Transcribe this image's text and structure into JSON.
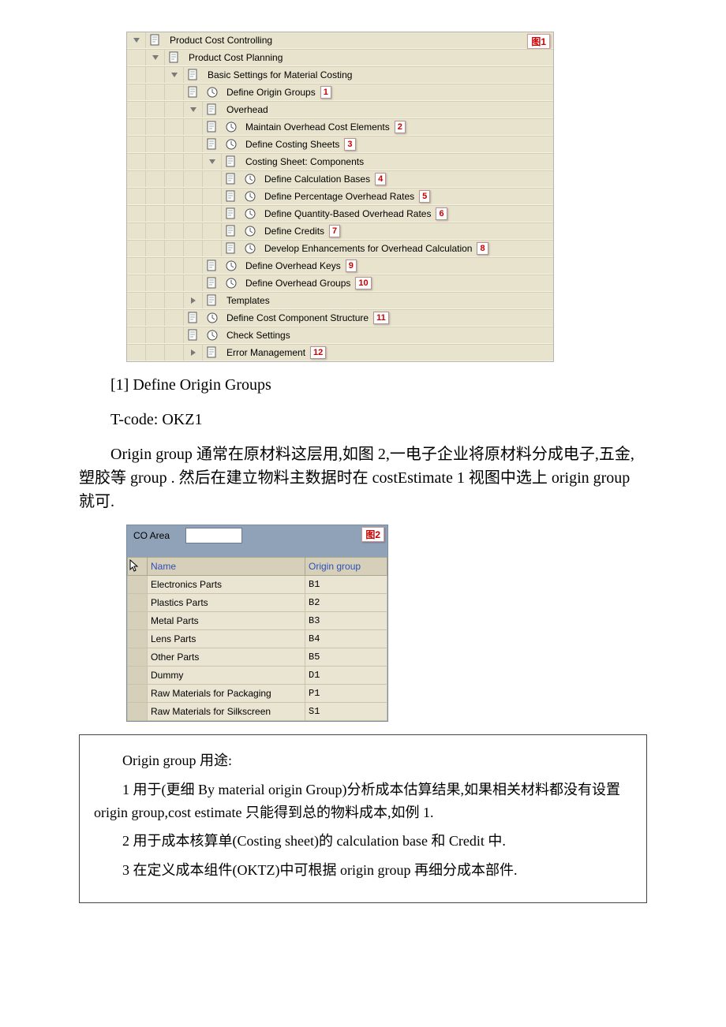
{
  "figure1_label": "图1",
  "figure2_label": "图2",
  "tree": {
    "node_pcc": "Product Cost Controlling",
    "node_pcp": "Product Cost Planning",
    "node_bsmc": "Basic Settings for Material Costing",
    "node_dog": "Define Origin Groups",
    "node_oh": "Overhead",
    "node_moce": "Maintain Overhead Cost Elements",
    "node_dcs": "Define Costing Sheets",
    "node_csc": "Costing Sheet: Components",
    "node_dcb": "Define Calculation Bases",
    "node_dpor": "Define Percentage Overhead Rates",
    "node_dqbor": "Define Quantity-Based Overhead Rates",
    "node_dc": "Define Credits",
    "node_deoc": "Develop Enhancements for Overhead Calculation",
    "node_dok": "Define Overhead Keys",
    "node_dogr": "Define Overhead Groups",
    "node_tpl": "Templates",
    "node_dccs": "Define Cost Component Structure",
    "node_cs": "Check Settings",
    "node_em": "Error Management",
    "nums": {
      "n1": "1",
      "n2": "2",
      "n3": "3",
      "n4": "4",
      "n5": "5",
      "n6": "6",
      "n7": "7",
      "n8": "8",
      "n9": "9",
      "n10": "10",
      "n11": "11",
      "n12": "12"
    }
  },
  "text": {
    "p1": "[1] Define Origin Groups",
    "p2": "T-code: OKZ1",
    "p3": "Origin group 通常在原材料这层用,如图 2,一电子企业将原材料分成电子,五金,塑胶等 group . 然后在建立物料主数据时在 costEstimate 1 视图中选上 origin group 就可."
  },
  "co_area": {
    "label": "CO Area",
    "col_name": "Name",
    "col_group": "Origin group",
    "rows": [
      {
        "name": "Electronics Parts",
        "group": "B1"
      },
      {
        "name": "Plastics Parts",
        "group": "B2"
      },
      {
        "name": "Metal Parts",
        "group": "B3"
      },
      {
        "name": "Lens Parts",
        "group": "B4"
      },
      {
        "name": "Other Parts",
        "group": "B5"
      },
      {
        "name": "Dummy",
        "group": "D1"
      },
      {
        "name": "Raw Materials for Packaging",
        "group": "P1"
      },
      {
        "name": "Raw Materials for Silkscreen",
        "group": "S1"
      }
    ]
  },
  "notes": {
    "title": "Origin group 用途:",
    "n1": "1 用于(更细 By material origin Group)分析成本估算结果,如果相关材料都没有设置 origin group,cost estimate 只能得到总的物料成本,如例 1.",
    "n2": "2 用于成本核算单(Costing sheet)的 calculation base 和 Credit 中.",
    "n3": "3 在定义成本组件(OKTZ)中可根据 origin group 再细分成本部件."
  }
}
